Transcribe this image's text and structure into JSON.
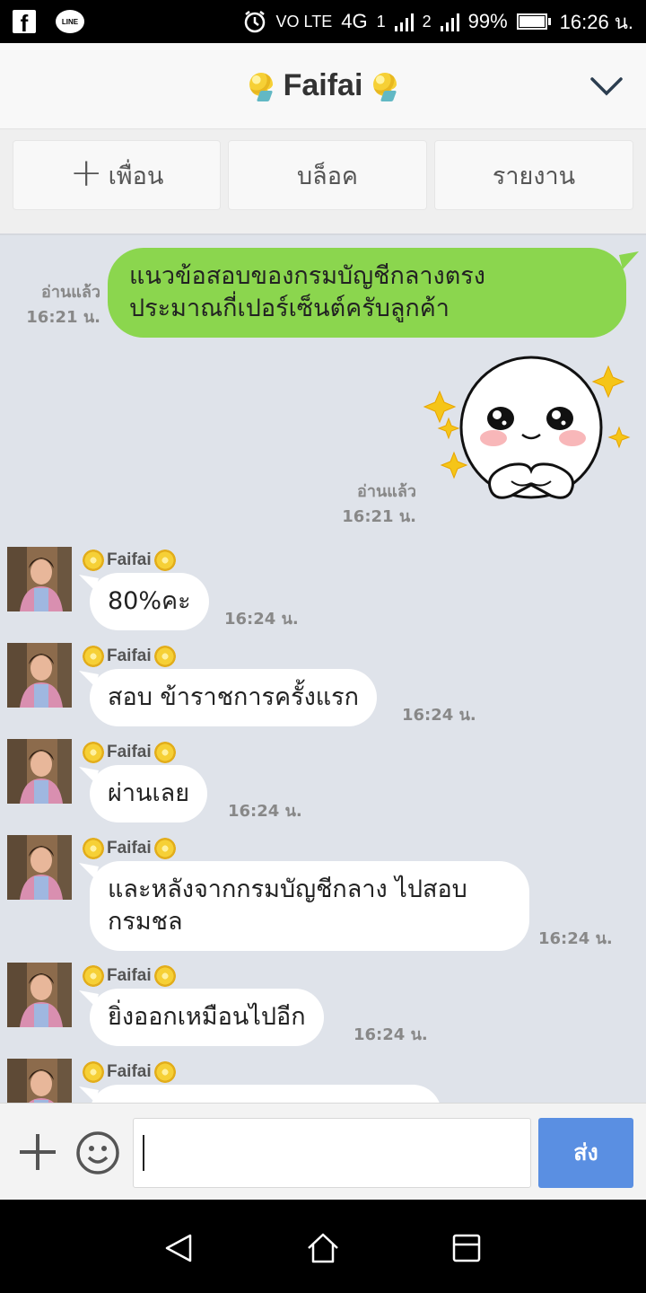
{
  "status_bar": {
    "left_icons": [
      "facebook-icon",
      "line-icon"
    ],
    "line_icon_text": "LINE",
    "volte": "VO LTE",
    "network": "4G",
    "sim1": "1",
    "sim2": "2",
    "battery": "99%",
    "time": "16:26 น."
  },
  "header": {
    "title": "Faifai",
    "icon_left": "bouquet-icon",
    "icon_right": "bouquet-icon",
    "collapse_icon": "chevron-down-icon"
  },
  "actions": {
    "add_friend": "เพื่อน",
    "block": "บล็อค",
    "report": "รายงาน"
  },
  "messages": {
    "m1": {
      "status": "อ่านแล้ว",
      "time": "16:21 น.",
      "line1": "แนวข้อสอบของกรมบัญชีกลางตรง",
      "line2": "ประมาณกี่เปอร์เซ็นต์ครับลูกค้า"
    },
    "m2": {
      "status": "อ่านแล้ว",
      "time": "16:21 น.",
      "sticker": "pleading-face-sticker"
    },
    "sender_name": "Faifai",
    "m3": {
      "text": "80%คะ",
      "time": "16:24 น."
    },
    "m4": {
      "text": "สอบ ข้าราชการครั้งแรก",
      "time": "16:24 น."
    },
    "m5": {
      "text": "ผ่านเลย",
      "time": "16:24 น."
    },
    "m6": {
      "line1": "และหลังจากกรมบัญชีกลาง ไปสอบ",
      "line2": "กรมชล",
      "time": "16:24 น."
    },
    "m7": {
      "text": "ยิ่งออกเหมือนไปอีก",
      "time": "16:24 น."
    }
  },
  "input_bar": {
    "plus_icon": "plus-icon",
    "emoji_icon": "emoji-icon",
    "text_value": "",
    "send_label": "ส่ง"
  },
  "nav_bar": {
    "back": "back-icon",
    "home": "home-icon",
    "recents": "recents-icon"
  },
  "colors": {
    "my_bubble": "#8bd64e",
    "their_bubble": "#ffffff",
    "chat_bg": "#dfe3ea",
    "send_button": "#5a8fe2"
  }
}
